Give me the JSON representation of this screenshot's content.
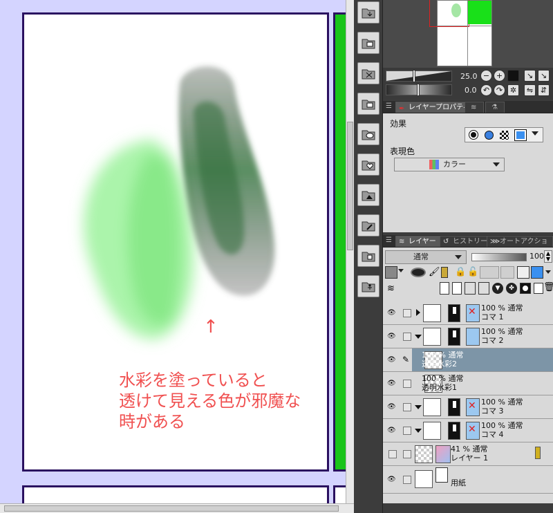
{
  "annotation": {
    "arrow": "↑",
    "text": "水彩を塗っていると\n透けて見える色が邪魔な\n時がある"
  },
  "tool_column": {
    "buttons": [
      "folder-download-icon",
      "folder-image-icon",
      "folder-cross-icon",
      "folder-edit-icon",
      "folder-balloon-icon",
      "folder-heart-icon",
      "folder-mountain-icon",
      "folder-pen-icon",
      "folder-cube-icon",
      "figure-icon"
    ]
  },
  "navigator": {
    "zoom_value": "25.0",
    "rotate_value": "0.0"
  },
  "properties_panel": {
    "tabs": [
      "レイヤープロパティ",
      "",
      ""
    ],
    "effect_label": "効果",
    "expression_label": "表現色",
    "expression_value": "カラー"
  },
  "layer_panel": {
    "tabs": [
      "レイヤー",
      "ヒストリー",
      "オートアクション"
    ],
    "blend_mode": "通常",
    "opacity": "100"
  },
  "layers": [
    {
      "line1": "100 % 通常",
      "line2": "コマ 1",
      "type": "folder",
      "expanded": false,
      "selected": false
    },
    {
      "line1": "100 % 通常",
      "line2": "コマ 2",
      "type": "folder",
      "expanded": true,
      "selected": false
    },
    {
      "line1": "100 % 通常",
      "line2": "透明水彩2",
      "type": "raster",
      "selected": true
    },
    {
      "line1": "100 % 通常",
      "line2": "透明水彩1",
      "type": "raster",
      "selected": false
    },
    {
      "line1": "100 % 通常",
      "line2": "コマ 3",
      "type": "folder",
      "expanded": true,
      "selected": false
    },
    {
      "line1": "100 % 通常",
      "line2": "コマ 4",
      "type": "folder",
      "expanded": true,
      "selected": false
    },
    {
      "line1": "41 % 通常",
      "line2": "レイヤー 1",
      "type": "raster",
      "selected": false
    },
    {
      "line1": "",
      "line2": "用紙",
      "type": "paper",
      "selected": false
    }
  ],
  "colors": {
    "canvas_bg": "#d4d4ff",
    "frame_border": "#2a1060",
    "green_panel": "#19c419",
    "annotation": "#f05050",
    "selected_layer": "#7d95a7"
  }
}
